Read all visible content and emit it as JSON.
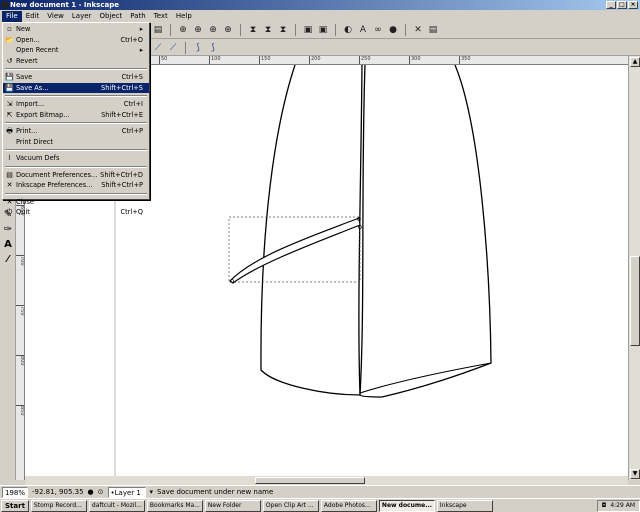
{
  "window": {
    "title": "New document 1 - Inkscape"
  },
  "menubar": [
    "File",
    "Edit",
    "View",
    "Layer",
    "Object",
    "Path",
    "Text",
    "Help"
  ],
  "file_menu": [
    {
      "label": "New",
      "shortcut": "",
      "icon": "new-document-icon",
      "glyph": "▫",
      "submenu": true
    },
    {
      "label": "Open...",
      "shortcut": "Ctrl+O",
      "icon": "open-folder-icon",
      "glyph": "📂"
    },
    {
      "label": "Open Recent",
      "shortcut": "",
      "icon": "blank-icon",
      "glyph": "",
      "submenu": true
    },
    {
      "label": "Revert",
      "shortcut": "",
      "icon": "revert-icon",
      "glyph": "↺"
    },
    {
      "sep": true
    },
    {
      "label": "Save",
      "shortcut": "Ctrl+S",
      "icon": "save-icon",
      "glyph": "💾"
    },
    {
      "label": "Save As...",
      "shortcut": "Shift+Ctrl+S",
      "icon": "save-as-icon",
      "glyph": "💾",
      "highlight": true
    },
    {
      "sep": true
    },
    {
      "label": "Import...",
      "shortcut": "Ctrl+I",
      "icon": "import-icon",
      "glyph": "⇲"
    },
    {
      "label": "Export Bitmap...",
      "shortcut": "Shift+Ctrl+E",
      "icon": "export-bitmap-icon",
      "glyph": "⇱"
    },
    {
      "sep": true
    },
    {
      "label": "Print...",
      "shortcut": "Ctrl+P",
      "icon": "print-icon",
      "glyph": "🖶"
    },
    {
      "label": "Print Direct",
      "shortcut": "",
      "icon": "blank-icon",
      "glyph": ""
    },
    {
      "sep": true
    },
    {
      "label": "Vacuum Defs",
      "shortcut": "",
      "icon": "vacuum-icon",
      "glyph": "⌇"
    },
    {
      "sep": true
    },
    {
      "label": "Document Preferences...",
      "shortcut": "Shift+Ctrl+D",
      "icon": "document-properties-icon",
      "glyph": "▤"
    },
    {
      "label": "Inkscape Preferences...",
      "shortcut": "Shift+Ctrl+P",
      "icon": "preferences-icon",
      "glyph": "✕"
    },
    {
      "sep": true
    },
    {
      "label": "Close",
      "shortcut": "",
      "icon": "close-icon",
      "glyph": "✕"
    },
    {
      "label": "Quit",
      "shortcut": "Ctrl+Q",
      "icon": "quit-icon",
      "glyph": "⏻"
    }
  ],
  "ruler": {
    "h_ticks": [
      "50",
      "100",
      "150",
      "200",
      "250",
      "300",
      "350"
    ],
    "v_ticks": [
      "500",
      "550",
      "600",
      "650",
      "700",
      "750",
      "800",
      "850"
    ]
  },
  "statusbar": {
    "zoom": "198%",
    "coords": "-92.81, 905.35",
    "layer": "•Layer 1",
    "message": "Save document under new name"
  },
  "taskbar": {
    "start": "Start",
    "tasks": [
      {
        "label": "Stomp Record...",
        "active": false
      },
      {
        "label": "daftcult - Mozil...",
        "active": false
      },
      {
        "label": "Bookmarks Ma...",
        "active": false
      },
      {
        "label": "New Folder",
        "active": false
      },
      {
        "label": "Open Clip Art ...",
        "active": false
      },
      {
        "label": "Adobe Photos...",
        "active": false
      },
      {
        "label": "New docume...",
        "active": true
      },
      {
        "label": "Inkscape",
        "active": false
      }
    ],
    "time": "4:29 AM"
  }
}
